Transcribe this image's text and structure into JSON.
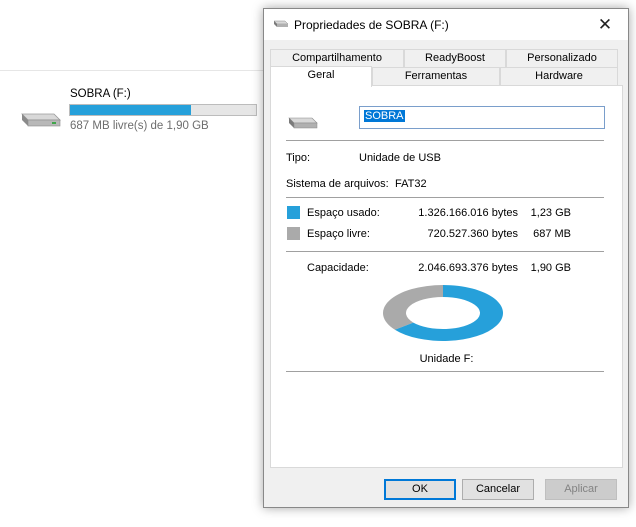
{
  "explorer": {
    "drive_name": "SOBRA (F:)",
    "free_text": "687 MB livre(s) de 1,90 GB",
    "used_fraction": 0.648
  },
  "dialog": {
    "title": "Propriedades de SOBRA (F:)",
    "close_glyph": "✕",
    "tabs_back": [
      "Compartilhamento",
      "ReadyBoost",
      "Personalizado"
    ],
    "tabs_front": [
      "Geral",
      "Ferramentas",
      "Hardware"
    ],
    "active_tab": "Geral",
    "volume_name": "SOBRA",
    "type_label": "Tipo:",
    "type_value": "Unidade de USB",
    "fs_label": "Sistema de arquivos:",
    "fs_value": "FAT32",
    "used_label": "Espaço usado:",
    "used_bytes": "1.326.166.016 bytes",
    "used_size": "1,23 GB",
    "free_label": "Espaço livre:",
    "free_bytes": "720.527.360 bytes",
    "free_size": "687 MB",
    "capacity_label": "Capacidade:",
    "capacity_bytes": "2.046.693.376 bytes",
    "capacity_size": "1,90 GB",
    "drive_label": "Unidade F:",
    "used_fraction": 0.648,
    "ok_label": "OK",
    "cancel_label": "Cancelar",
    "apply_label": "Aplicar"
  },
  "colors": {
    "used": "#26a0da",
    "free": "#aaaaaa",
    "accent": "#0078d7"
  },
  "icons": [
    "usb-drive-icon",
    "close-icon"
  ]
}
